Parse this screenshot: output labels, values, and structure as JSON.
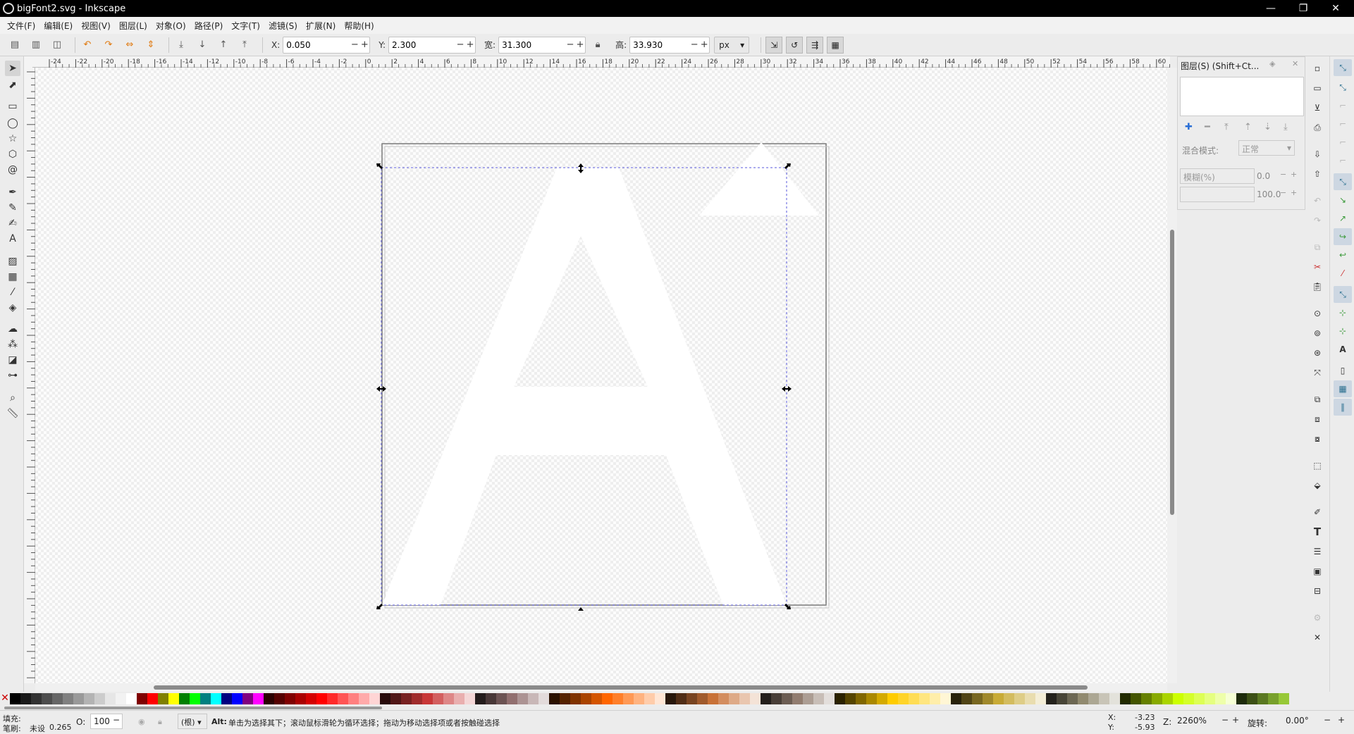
{
  "window": {
    "title": "bigFont2.svg - Inkscape",
    "controls": [
      "—",
      "❐",
      "✕"
    ]
  },
  "menu": [
    "文件(F)",
    "编辑(E)",
    "视图(V)",
    "图层(L)",
    "对象(O)",
    "路径(P)",
    "文字(T)",
    "滤镜(S)",
    "扩展(N)",
    "帮助(H)"
  ],
  "toolbar": {
    "x_label": "X:",
    "x_value": "0.050",
    "y_label": "Y:",
    "y_value": "2.300",
    "w_label": "宽:",
    "w_value": "31.300",
    "h_label": "高:",
    "h_value": "33.930",
    "unit": "px",
    "minus": "−",
    "plus": "+"
  },
  "ruler": {
    "top_labels": [
      "-24",
      "-22",
      "-20",
      "-18",
      "-16",
      "-14",
      "-12",
      "-10",
      "-8",
      "-6",
      "-4",
      "-2",
      "0",
      "2",
      "4",
      "6",
      "8",
      "10",
      "12",
      "14",
      "16",
      "18",
      "20",
      "22",
      "24",
      "26",
      "28",
      "30",
      "32",
      "34",
      "36",
      "38",
      "40",
      "42",
      "44",
      "46",
      "48",
      "50",
      "52",
      "54",
      "56",
      "58",
      "60"
    ]
  },
  "layers_panel": {
    "title": "图层(S) (Shift+Ct...",
    "blend_label": "混合模式:",
    "blend_value": "正常",
    "blur_label": "模糊(%)",
    "blur_value": "0.0",
    "opacity_value": "100.0"
  },
  "palette": {
    "colors": [
      "#000000",
      "#1a1a1a",
      "#333333",
      "#4d4d4d",
      "#666666",
      "#808080",
      "#999999",
      "#b3b3b3",
      "#cccccc",
      "#e6e6e6",
      "#f2f2f2",
      "#ffffff",
      "#800000",
      "#ff0000",
      "#808000",
      "#ffff00",
      "#008000",
      "#00ff00",
      "#008080",
      "#00ffff",
      "#000080",
      "#0000ff",
      "#800080",
      "#ff00ff",
      "#2b0000",
      "#550000",
      "#800000",
      "#aa0000",
      "#d40000",
      "#ff0000",
      "#ff2a2a",
      "#ff5555",
      "#ff8080",
      "#ffaaaa",
      "#ffd5d5",
      "#280b0b",
      "#501616",
      "#782121",
      "#a02c2c",
      "#c83737",
      "#d35f5f",
      "#de8787",
      "#e9afaf",
      "#f4d7d7",
      "#241c1c",
      "#483737",
      "#6c5353",
      "#916f6f",
      "#ac9393",
      "#c8b7b7",
      "#e3dbdb",
      "#2b1100",
      "#552200",
      "#803300",
      "#aa4400",
      "#d45500",
      "#ff6600",
      "#ff7f2a",
      "#ff9955",
      "#ffb380",
      "#ffccaa",
      "#ffe6d5",
      "#28170b",
      "#502d16",
      "#784421",
      "#a05a2c",
      "#c87137",
      "#d38d5f",
      "#deaa87",
      "#e9c6af",
      "#f4e3d7",
      "#241f1c",
      "#483e37",
      "#6c5d53",
      "#917c6f",
      "#ac9d93",
      "#c8beb7",
      "#e3dedb",
      "#2b2200",
      "#554400",
      "#806600",
      "#aa8800",
      "#d4aa00",
      "#ffcc00",
      "#ffd42a",
      "#ffdd55",
      "#ffe680",
      "#ffeeaa",
      "#fff6d5",
      "#28220b",
      "#504416",
      "#786721",
      "#a0892c",
      "#c8ab37",
      "#d3bc5f",
      "#decd87",
      "#e9ddaf",
      "#f4eed7",
      "#24221c",
      "#484537",
      "#6c6753",
      "#918a6f",
      "#aca793",
      "#c8c4b7",
      "#e3e2db",
      "#222b00",
      "#445500",
      "#668000",
      "#88aa00",
      "#aad400",
      "#ccff00",
      "#d4ff2a",
      "#ddff55",
      "#e5ff80",
      "#eeffaa",
      "#f6ffd5",
      "#1e2b0b",
      "#3c5016",
      "#5a7821",
      "#78a02c",
      "#97c837"
    ]
  },
  "status": {
    "fill_label": "填充:",
    "stroke_label": "笔刷:",
    "stroke_value": "未设",
    "stroke_width": "0.265",
    "opacity_label": "O:",
    "opacity_value": "100",
    "layer_value": "(根)",
    "message_key": "Alt:",
    "message": "单击为选择其下；滚动鼠标滑轮为循环选择；拖动为移动选择项或者按触碰选择",
    "cursor_x_label": "X:",
    "cursor_x": "-3.23",
    "cursor_y_label": "Y:",
    "cursor_y": "-5.93",
    "zoom_label": "Z:",
    "zoom": "2260%",
    "rotate_label": "旋转:",
    "rotate": "0.00°"
  }
}
